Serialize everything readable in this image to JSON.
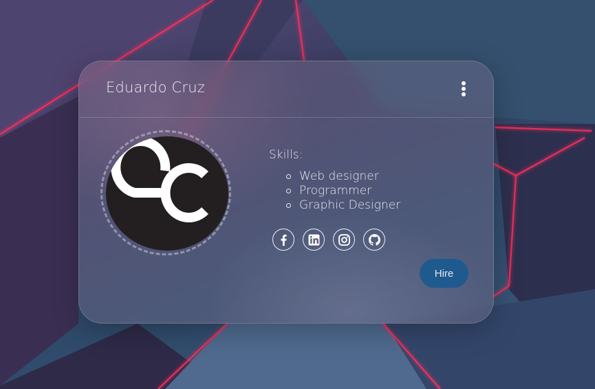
{
  "card": {
    "name": "Eduardo Cruz",
    "menu_icon": "more-vertical-icon",
    "avatar_logo_text": "EC",
    "skills_label": "Skills:",
    "skills": [
      "Web designer",
      "Programmer",
      "Graphic Designer"
    ],
    "socials": [
      {
        "name": "facebook",
        "icon": "facebook-icon"
      },
      {
        "name": "linkedin",
        "icon": "linkedin-icon"
      },
      {
        "name": "instagram",
        "icon": "instagram-icon"
      },
      {
        "name": "github",
        "icon": "github-icon"
      }
    ],
    "hire_label": "Hire"
  },
  "colors": {
    "hire_button": "#1f5a8f",
    "avatar_bg": "#231f20",
    "accent_lines": "#e0245e"
  }
}
